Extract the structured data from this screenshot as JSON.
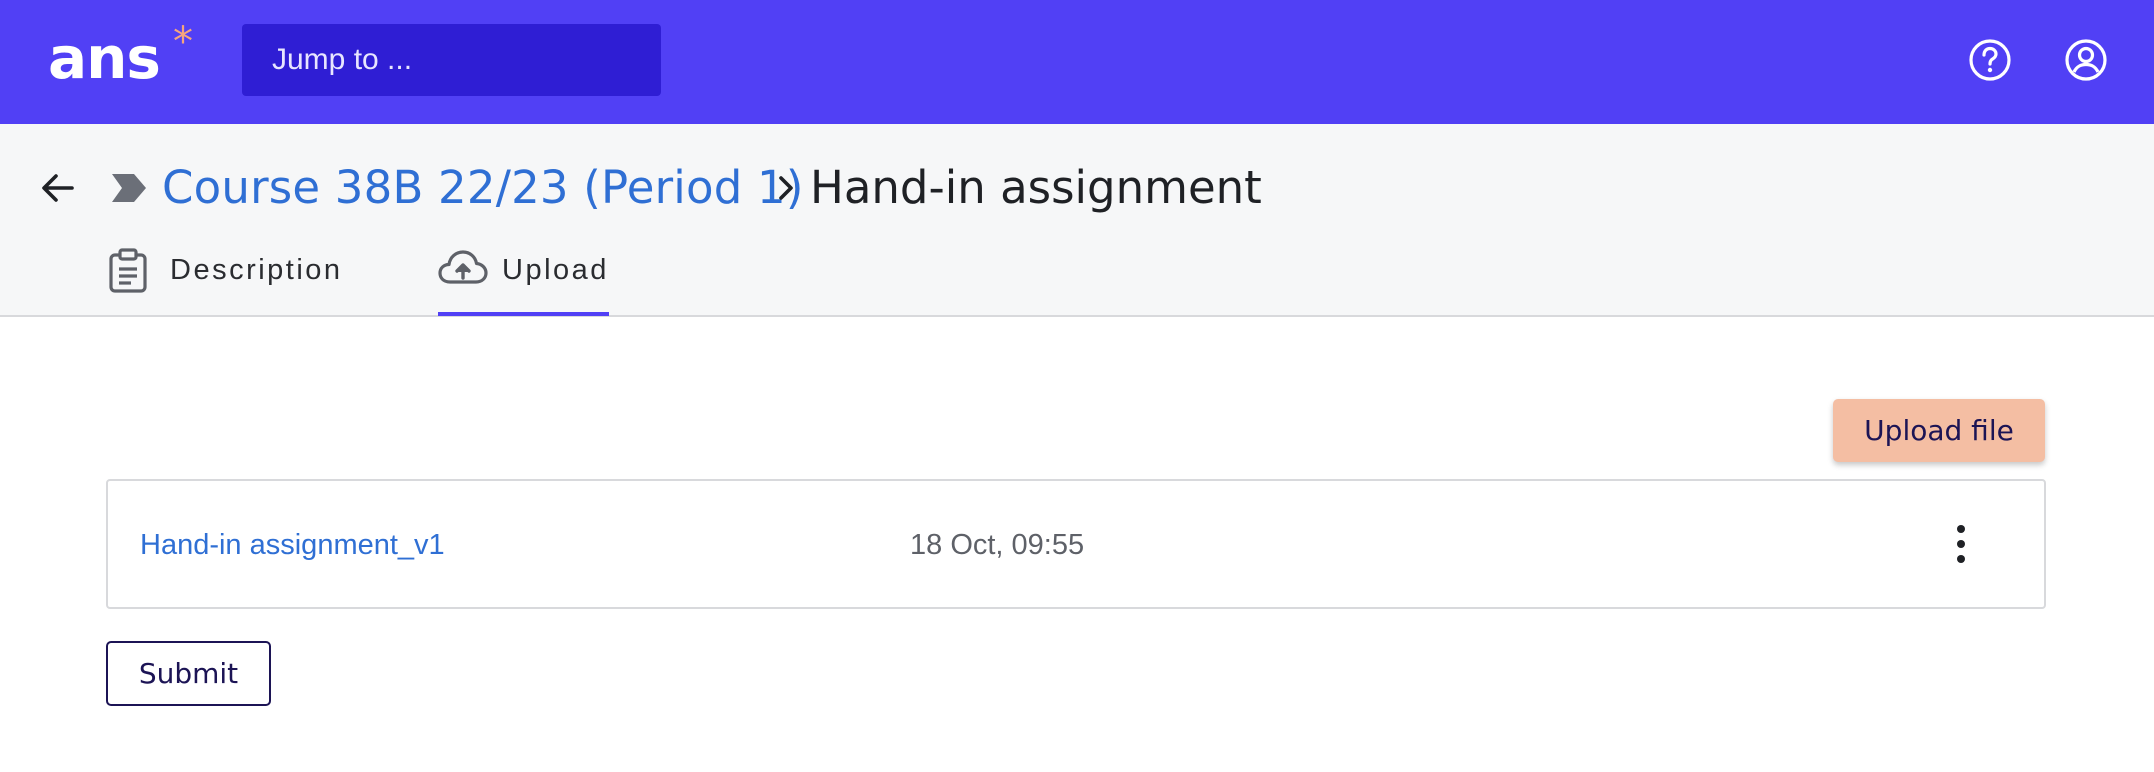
{
  "app": {
    "logo_text": "ans",
    "logo_mark": "*"
  },
  "topbar": {
    "search_placeholder": "Jump to ...",
    "help_icon": "help-circle-icon",
    "user_icon": "user-circle-icon"
  },
  "breadcrumb": {
    "back_icon": "arrow-left-icon",
    "course_icon": "chevron-tag-icon",
    "course": "Course 38B 22/23 (Period 1)",
    "separator": ">",
    "current": "Hand-in assignment"
  },
  "tabs": [
    {
      "label": "Description",
      "icon": "clipboard-icon",
      "active": false
    },
    {
      "label": "Upload",
      "icon": "cloud-upload-icon",
      "active": true
    }
  ],
  "upload": {
    "upload_button": "Upload file",
    "files": [
      {
        "name": "Hand-in assignment_v1",
        "date": "18 Oct, 09:55",
        "menu_icon": "more-vertical-icon"
      }
    ],
    "submit_button": "Submit"
  },
  "colors": {
    "brand": "#5140f5",
    "search_bg": "#2f1ed4",
    "link": "#2f6fd4",
    "upload_button": "#f4bea3",
    "logo_mark": "#f5a57e"
  }
}
